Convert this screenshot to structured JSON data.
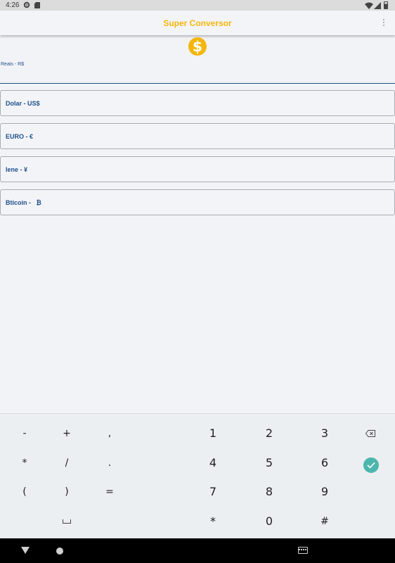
{
  "status_bar": {
    "time": "4:26"
  },
  "app_bar": {
    "title": "Super Conversor"
  },
  "coin_icon": {
    "glyph": "$",
    "color": "#f5b60b"
  },
  "reais_field": {
    "label": "Reais - R$",
    "value": ""
  },
  "currency_fields": [
    {
      "label": "Dolar - US$"
    },
    {
      "label": "EURO - €"
    },
    {
      "label": "Iene - ¥"
    },
    {
      "label": "Bticoin -   ₿"
    }
  ],
  "keyboard": {
    "symbols": [
      [
        "-",
        "+",
        ","
      ],
      [
        "*",
        "/",
        "."
      ],
      [
        "(",
        ")",
        "="
      ]
    ],
    "digits": [
      [
        "1",
        "2",
        "3"
      ],
      [
        "4",
        "5",
        "6"
      ],
      [
        "7",
        "8",
        "9"
      ],
      [
        "*",
        "0",
        "#"
      ]
    ]
  },
  "colors": {
    "accent": "#f5b60b",
    "label_blue": "#1e4f8a",
    "done_teal": "#4db6ac"
  }
}
